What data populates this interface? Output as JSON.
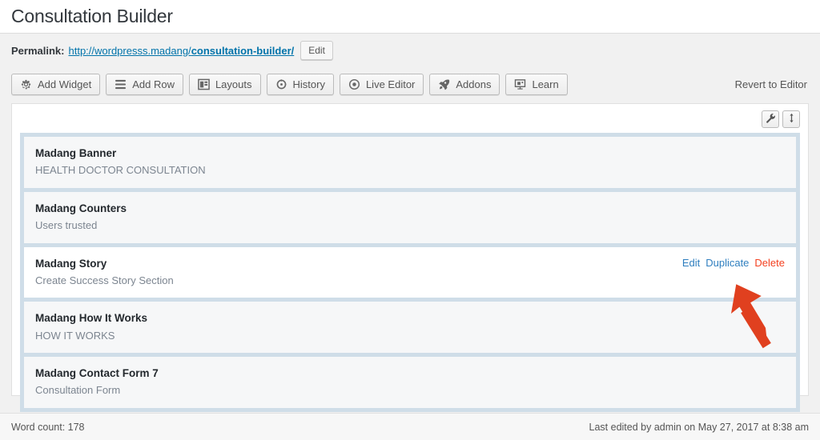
{
  "page": {
    "title": "Consultation Builder"
  },
  "permalink": {
    "label": "Permalink:",
    "url_prefix": "http://wordpresss.madang/",
    "url_slug": "consultation-builder/",
    "edit_button": "Edit"
  },
  "toolbar": {
    "buttons": [
      {
        "label": "Add Widget",
        "icon": "gear-icon"
      },
      {
        "label": "Add Row",
        "icon": "rows-icon"
      },
      {
        "label": "Layouts",
        "icon": "layout-icon"
      },
      {
        "label": "History",
        "icon": "history-icon"
      },
      {
        "label": "Live Editor",
        "icon": "eye-target-icon"
      },
      {
        "label": "Addons",
        "icon": "rocket-icon"
      },
      {
        "label": "Learn",
        "icon": "presentation-icon"
      }
    ],
    "revert_label": "Revert to Editor"
  },
  "panel_tools": [
    {
      "name": "wrench-icon"
    },
    {
      "name": "move-vertical-icon"
    }
  ],
  "widgets": [
    {
      "title": "Madang Banner",
      "description": "HEALTH DOCTOR CONSULTATION",
      "hovered": false
    },
    {
      "title": "Madang Counters",
      "description": "Users trusted",
      "hovered": false
    },
    {
      "title": "Madang Story",
      "description": "Create Success Story Section",
      "hovered": true
    },
    {
      "title": "Madang How It Works",
      "description": "HOW IT WORKS",
      "hovered": false
    },
    {
      "title": "Madang Contact Form 7",
      "description": "Consultation Form",
      "hovered": false
    }
  ],
  "row_actions": {
    "edit": "Edit",
    "duplicate": "Duplicate",
    "delete": "Delete"
  },
  "footer": {
    "word_count": "Word count: 178",
    "last_edited": "Last edited by admin on May 27, 2017 at 8:38 am"
  },
  "colors": {
    "link_blue": "#0073aa",
    "action_blue": "#2f7fbf",
    "delete_red": "#f4401f",
    "row_container_blue": "#cfdde8",
    "arrow_red": "#e0401f"
  }
}
